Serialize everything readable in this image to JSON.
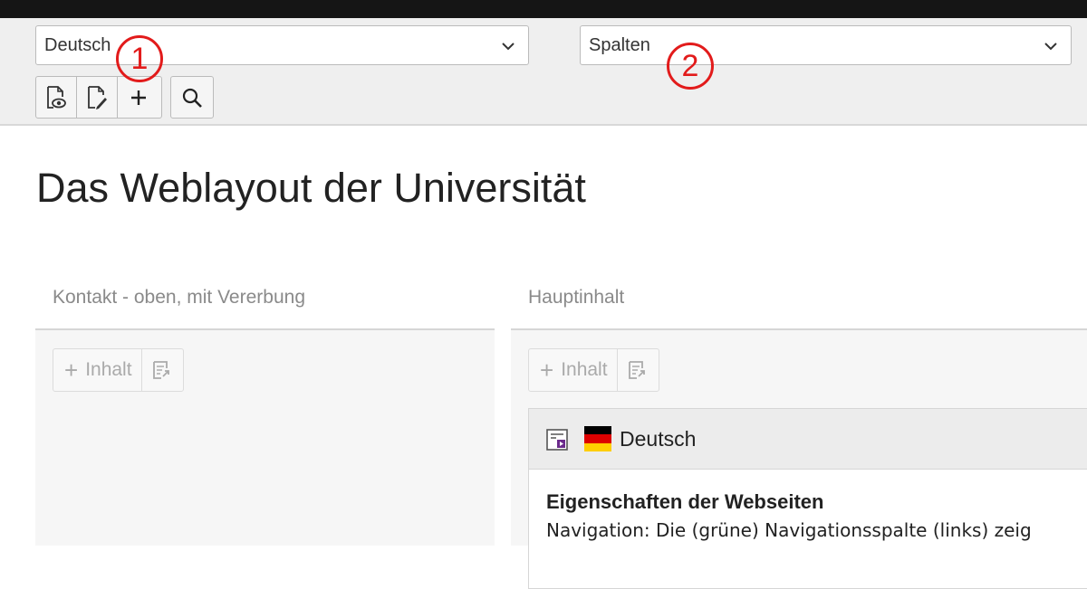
{
  "header": {
    "language_select": {
      "value": "Deutsch"
    },
    "view_select": {
      "value": "Spalten"
    },
    "annotations": [
      "1",
      "2"
    ]
  },
  "page": {
    "title": "Das Weblayout der Universität"
  },
  "columns": [
    {
      "label": "Kontakt - oben, mit Vererbung",
      "add_label": "Inhalt"
    },
    {
      "label": "Hauptinhalt",
      "add_label": "Inhalt"
    }
  ],
  "content_card": {
    "language": "Deutsch",
    "title": "Eigenschaften der Webseiten",
    "text": "Navigation: Die (grüne) Navigationsspalte (links) zeig"
  },
  "icons": {
    "view": "view-page-icon",
    "edit": "edit-page-icon",
    "new": "plus-icon",
    "search": "search-icon",
    "paste": "paste-icon",
    "content_type": "content-element-icon",
    "flag": "german-flag-icon"
  },
  "colors": {
    "annotation_red": "#e21b1b",
    "header_bg": "#efefef",
    "top_bar": "#151515"
  }
}
